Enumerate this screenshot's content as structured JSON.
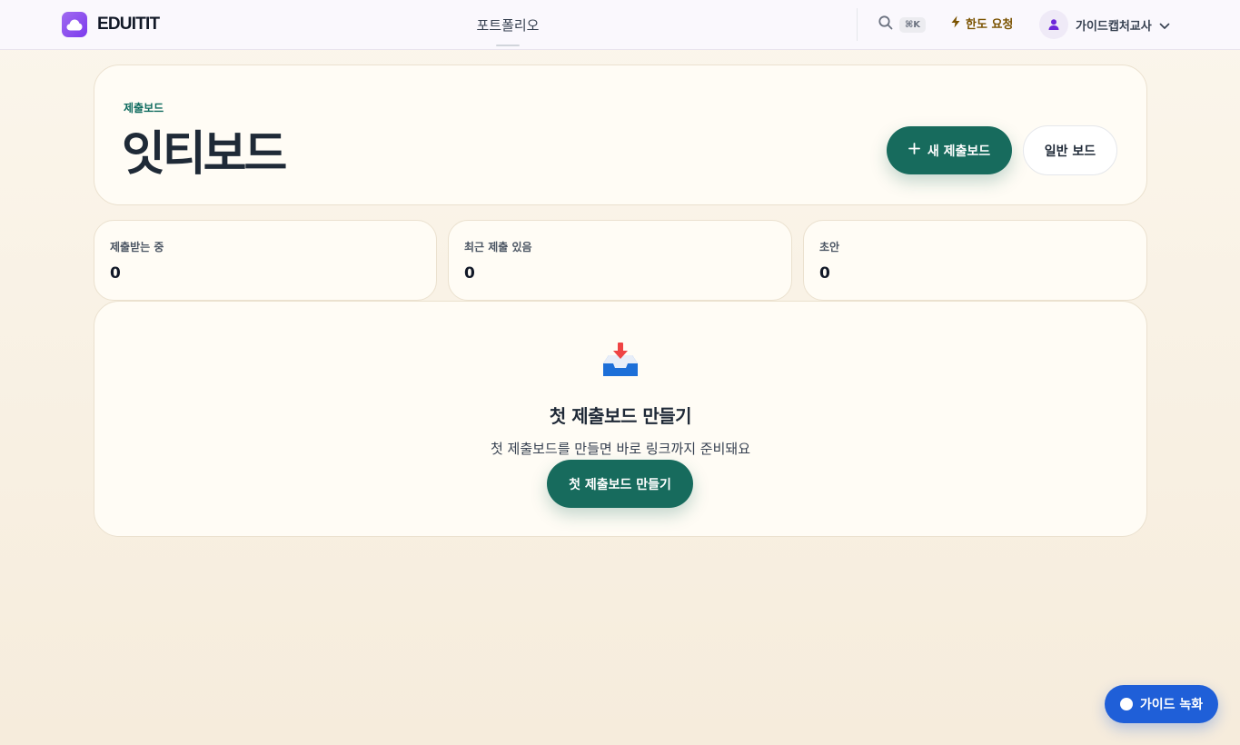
{
  "header": {
    "logo_text": "EDUITIT",
    "nav_tab": "포트폴리오",
    "search_shortcut": "⌘K",
    "quota_label": "한도 요청",
    "user_name": "가이드캡처교사"
  },
  "hero": {
    "eyebrow": "제출보드",
    "title": "잇티보드",
    "primary_button": "새 제출보드",
    "secondary_button": "일반 보드"
  },
  "stats": [
    {
      "label": "제출받는 중",
      "value": "0"
    },
    {
      "label": "최근 제출 있음",
      "value": "0"
    },
    {
      "label": "초안",
      "value": "0"
    }
  ],
  "empty_state": {
    "icon": "inbox-tray-icon",
    "title": "첫 제출보드 만들기",
    "subtitle": "첫 제출보드를 만들면 바로 링크까지 준비돼요",
    "button": "첫 제출보드 만들기"
  },
  "fab": {
    "label": "가이드 녹화"
  },
  "colors": {
    "accent": "#176b5d",
    "brand": "#7c3aed",
    "fab": "#1f5fd8",
    "quota": "#7a5200"
  }
}
